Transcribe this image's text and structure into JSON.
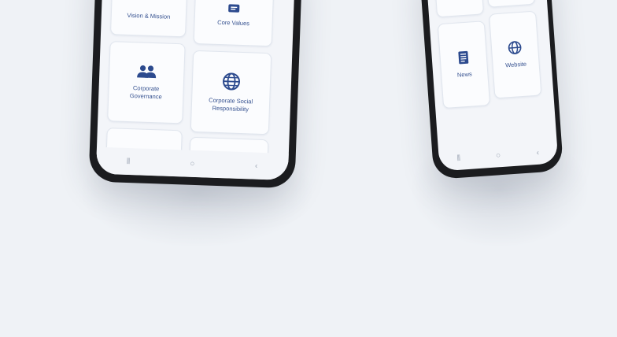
{
  "left_phone": {
    "cards": [
      {
        "label": "Vision & Mission",
        "icon": "vision-icon"
      },
      {
        "label": "Core Values",
        "icon": "core-values-icon"
      },
      {
        "label": "Corporate Governance",
        "icon": "people-icon"
      },
      {
        "label": "Corporate Social Responsibility",
        "icon": "globe-icon"
      }
    ],
    "nav": {
      "recents": "⦀",
      "home": "○",
      "back": "‹"
    }
  },
  "right_phone": {
    "cards": [
      {
        "label": "News",
        "icon": "document-icon"
      },
      {
        "label": "Website",
        "icon": "globe-icon"
      }
    ],
    "nav": {
      "recents": "⦀",
      "home": "○",
      "back": "‹"
    }
  },
  "colors": {
    "background": "#eff2f6",
    "accent": "#2c4a8e",
    "frame": "#1b1c1f"
  }
}
